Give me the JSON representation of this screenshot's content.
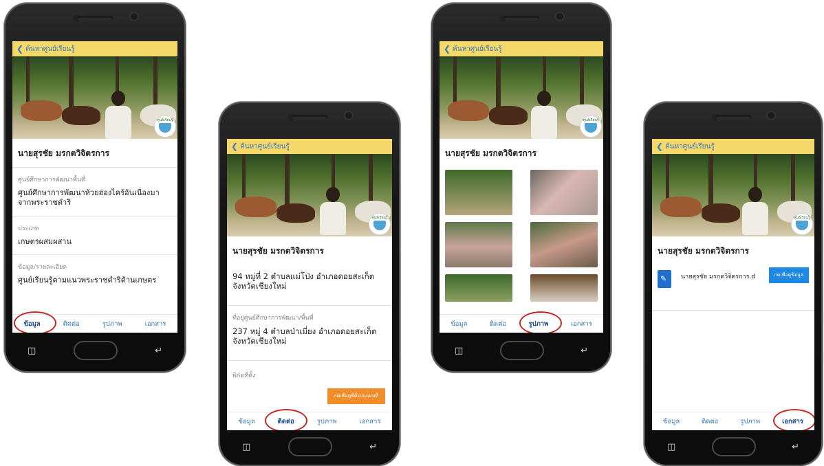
{
  "app": {
    "back_label": "ค้นหาศูนย์เรียนรู้",
    "badge_label": "ศูนย์เรียนรู้"
  },
  "profile": {
    "name": "นายสุรชัย มรกตวิจิตรการ"
  },
  "tabs": {
    "info": "ข้อมูล",
    "contact": "ติดต่อ",
    "photos": "รูปภาพ",
    "documents": "เอกสาร"
  },
  "screen1": {
    "sections": [
      {
        "label": "ศูนย์ศึกษาการพัฒนาพื้นที่",
        "value": "ศูนย์ศึกษาการพัฒนาห้วยฮ่องไคร้อันเนื่องมาจากพระราชดำริ"
      },
      {
        "label": "ประเภท",
        "value": "เกษตรผสมผสาน"
      },
      {
        "label": "ข้อมูล/รายละเอียด",
        "value": "ศูนย์เรียนรู้ตามแนวพระราชดำริด้านเกษตร"
      }
    ]
  },
  "screen2": {
    "address": "94 หมู่ที่ 2 ตำบลแม่โป่ง อำเภอดอยสะเก็ต จังหวัดเชียงใหม่",
    "center_label": "ที่อยู่ศูนย์ศึกษาการพัฒนา/พื้นที่",
    "center_address": "237 หมู่ 4 ตำบลป่าเมี่ยง อำเภอดอยสะเก็ต จังหวัดเชียงใหม่",
    "coords_label": "พิกัดที่ตั้ง",
    "map_button": "กดเพื่อดูที่ตั้งบนแผนที่"
  },
  "screen4": {
    "file_name": "นายสุรชัย มรกตวิจิตรการ.d",
    "view_button": "กดเพื่อดูข้อมูล"
  },
  "colors": {
    "appbar": "#f4d86a",
    "link": "#3b78b6",
    "highlight_ring": "#c62828",
    "map_button": "#f28c28",
    "view_button": "#1e88e5"
  }
}
